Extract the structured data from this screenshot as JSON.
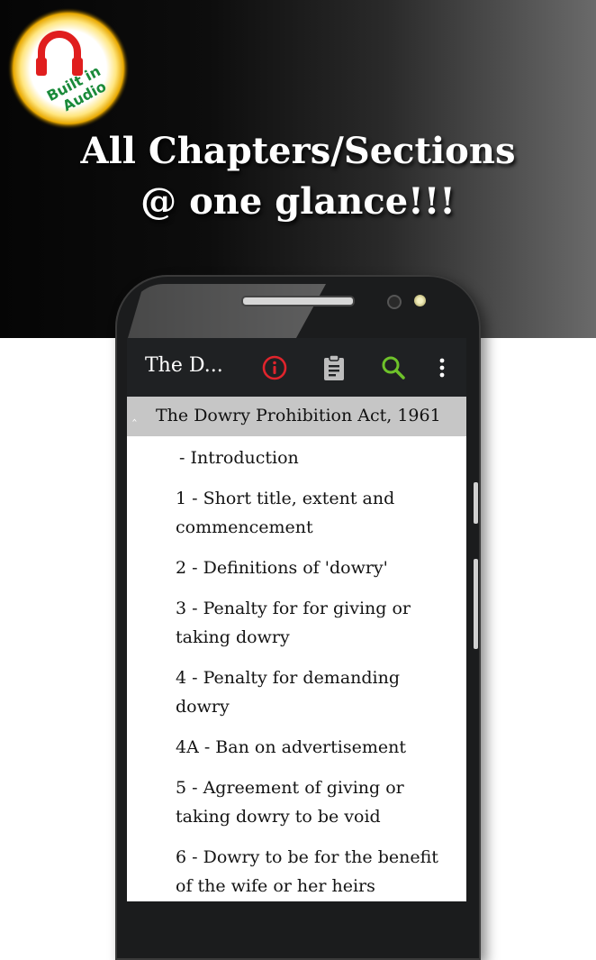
{
  "badge": {
    "icon": "headphones-icon",
    "line1": "Built in",
    "line2": "Audio",
    "colors": {
      "icon": "#e01e1e",
      "text": "#1a8a3a",
      "glow": "#f5c400"
    }
  },
  "headline": {
    "line1": "All Chapters/Sections",
    "line2": "@ one glance!!!"
  },
  "appbar": {
    "title": "The D...",
    "icons": [
      {
        "name": "info-icon",
        "color": "#e0242c"
      },
      {
        "name": "clipboard-icon",
        "color": "#bdbdbd"
      },
      {
        "name": "search-icon",
        "color": "#6ec22a"
      },
      {
        "name": "more-vert-icon",
        "color": "#ffffff"
      }
    ]
  },
  "act": {
    "title": "The Dowry Prohibition Act, 1961",
    "expanded": true,
    "sections": [
      {
        "label": " - Introduction"
      },
      {
        "label": "1 - Short title, extent and commencement"
      },
      {
        "label": "2 - Definitions of 'dowry'"
      },
      {
        "label": "3 - Penalty for for giving or taking dowry"
      },
      {
        "label": "4 - Penalty for demanding dowry"
      },
      {
        "label": "4A - Ban on advertisement"
      },
      {
        "label": "5 - Agreement of giving or taking dowry to be void"
      },
      {
        "label": "6 - Dowry to be for the benefit of the wife or her heirs"
      }
    ]
  }
}
